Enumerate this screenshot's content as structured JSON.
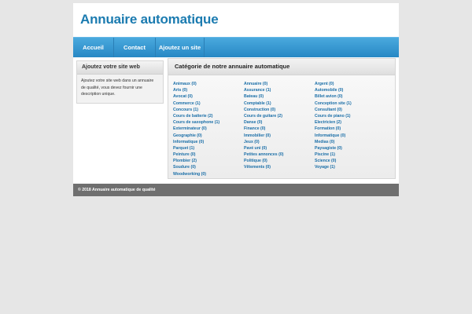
{
  "header": {
    "title": "Annuaire automatique"
  },
  "nav": {
    "items": [
      "Accueil",
      "Contact",
      "Ajoutez un site"
    ]
  },
  "sidebar": {
    "title": "Ajoutez votre site web",
    "text": "Ajoutez votre site web dans un annuaire de qualité, vous devez fournir une description unique."
  },
  "main": {
    "title": "Catégorie de notre annuaire automatique",
    "columns": [
      [
        "Animaux (0)",
        "Arts (0)",
        "Avocat (0)",
        "Commerce (1)",
        "Concours (1)",
        "Cours de batterie (2)",
        "Cours de saxophone (1)",
        "Exterminateur (0)",
        "Geographie (0)",
        "Informatique (0)",
        "Parquet (1)",
        "Peinture (0)",
        "Plombier (2)",
        "Soudure (0)",
        "Woodworking (0)"
      ],
      [
        "Annuaire (0)",
        "Assurance (1)",
        "Bateau (0)",
        "Comptable (1)",
        "Construction (0)",
        "Cours de guitare (2)",
        "Danse (0)",
        "Finance (0)",
        "Immobilier (0)",
        "Jeux (0)",
        "Pavé uni (0)",
        "Petites annonces (0)",
        "Politique (0)",
        "Vêtements (0)"
      ],
      [
        "Argent (0)",
        "Automobile (0)",
        "Billet avion (0)",
        "Conception site (1)",
        "Consultant (0)",
        "Cours de piano (1)",
        "Electricien (2)",
        "Formation (0)",
        "Informatique (0)",
        "Medias (0)",
        "Paysagiste (0)",
        "Piscine (1)",
        "Science (0)",
        "Voyage (1)"
      ]
    ]
  },
  "footer": {
    "text": "© 2018 Annuaire automatique de qualité"
  },
  "colors": {
    "brand": "#1b7bb0",
    "nav": "#2f93d0",
    "link": "#1b6fa8",
    "footer": "#6f6f6f"
  }
}
